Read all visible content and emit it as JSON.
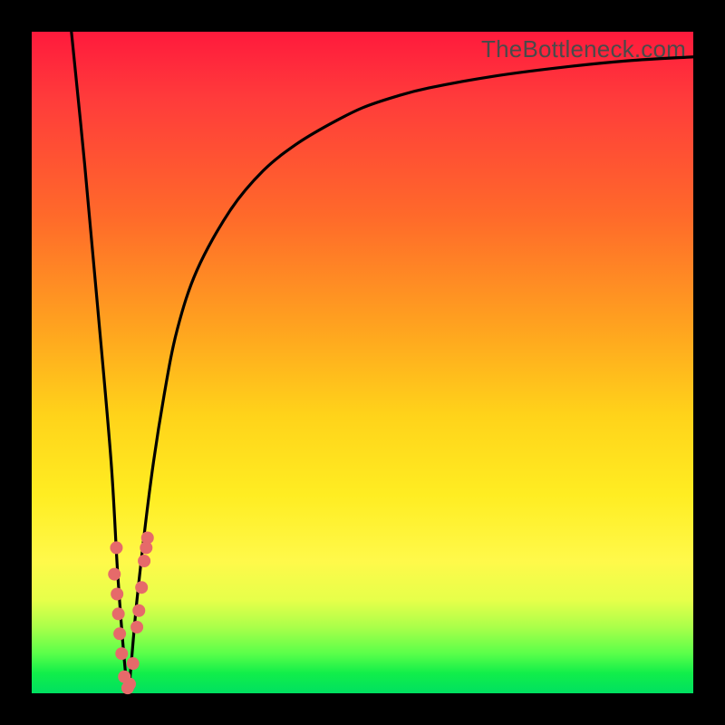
{
  "watermark": "TheBottleneck.com",
  "colors": {
    "frame_bg": "#000000",
    "curve_stroke": "#000000",
    "marker_fill": "#e66a6a",
    "marker_stroke": "#c94f4f",
    "gradient_top": "#ff1a3c",
    "gradient_bottom": "#00e060"
  },
  "chart_data": {
    "type": "line",
    "title": "",
    "xlabel": "",
    "ylabel": "",
    "xlim": [
      0,
      100
    ],
    "ylim": [
      0,
      100
    ],
    "grid": false,
    "legend": false,
    "series": [
      {
        "name": "bottleneck-curve",
        "x": [
          6,
          8,
          10,
          12,
          13,
          14,
          14.6,
          15,
          16,
          18,
          20,
          22,
          25,
          30,
          35,
          40,
          45,
          50,
          55,
          60,
          70,
          80,
          90,
          100
        ],
        "y": [
          100,
          80,
          58,
          35,
          18,
          5,
          0,
          4,
          15,
          32,
          45,
          55,
          64,
          73,
          79,
          83,
          86,
          88.5,
          90.2,
          91.5,
          93.3,
          94.6,
          95.6,
          96.2
        ]
      }
    ],
    "markers": [
      {
        "x": 12.8,
        "y": 22
      },
      {
        "x": 12.5,
        "y": 18
      },
      {
        "x": 12.9,
        "y": 15
      },
      {
        "x": 13.1,
        "y": 12
      },
      {
        "x": 13.3,
        "y": 9
      },
      {
        "x": 13.6,
        "y": 6
      },
      {
        "x": 14.0,
        "y": 2.5
      },
      {
        "x": 14.5,
        "y": 0.8
      },
      {
        "x": 14.8,
        "y": 1.4
      },
      {
        "x": 15.3,
        "y": 4.5
      },
      {
        "x": 15.9,
        "y": 10
      },
      {
        "x": 16.2,
        "y": 12.5
      },
      {
        "x": 16.6,
        "y": 16
      },
      {
        "x": 17.0,
        "y": 20
      },
      {
        "x": 17.3,
        "y": 22
      },
      {
        "x": 17.5,
        "y": 23.5
      }
    ],
    "annotations": []
  }
}
